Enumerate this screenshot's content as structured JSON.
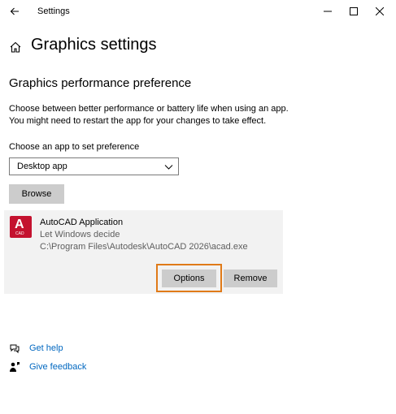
{
  "window": {
    "title": "Settings"
  },
  "header": {
    "title": "Graphics settings"
  },
  "section": {
    "title": "Graphics performance preference",
    "description_line1": "Choose between better performance or battery life when using an app.",
    "description_line2": "You might need to restart the app for your changes to take effect."
  },
  "chooser": {
    "label": "Choose an app to set preference",
    "selected": "Desktop app",
    "browse_label": "Browse"
  },
  "app": {
    "icon_letter": "A",
    "icon_caption": "CAD",
    "name": "AutoCAD Application",
    "preference": "Let Windows decide",
    "path": "C:\\Program Files\\Autodesk\\AutoCAD 2026\\acad.exe",
    "options_label": "Options",
    "remove_label": "Remove"
  },
  "links": {
    "help": "Get help",
    "feedback": "Give feedback"
  },
  "colors": {
    "accent_link": "#0067c0",
    "highlight": "#e07a18",
    "app_icon": "#c4122f"
  }
}
